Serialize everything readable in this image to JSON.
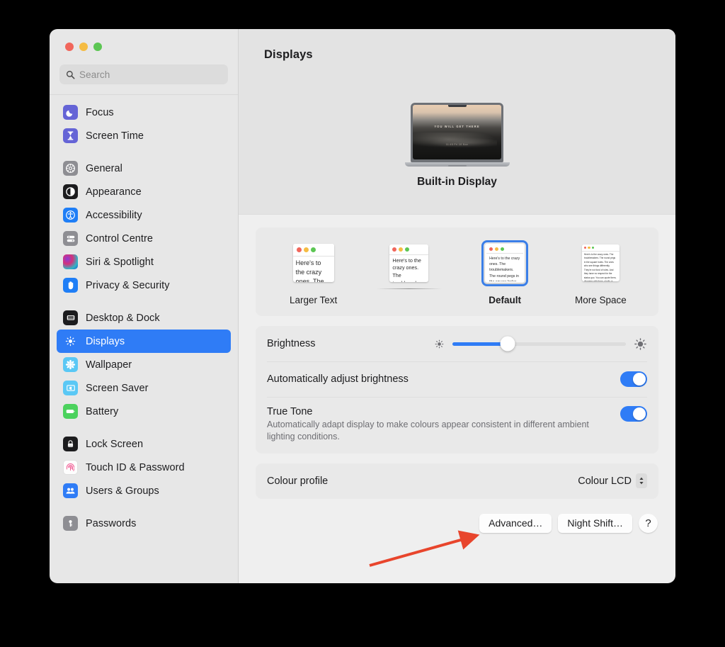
{
  "window": {
    "traffic_lights": [
      "close",
      "minimise",
      "zoom"
    ]
  },
  "sidebar": {
    "search": {
      "placeholder": "Search",
      "value": ""
    },
    "groups": [
      {
        "items": [
          {
            "label": "Focus",
            "icon": "moon-icon"
          },
          {
            "label": "Screen Time",
            "icon": "hourglass-icon"
          }
        ]
      },
      {
        "items": [
          {
            "label": "General",
            "icon": "gear-icon"
          },
          {
            "label": "Appearance",
            "icon": "appearance-icon"
          },
          {
            "label": "Accessibility",
            "icon": "accessibility-icon"
          },
          {
            "label": "Control Centre",
            "icon": "control-centre-icon"
          },
          {
            "label": "Siri & Spotlight",
            "icon": "siri-icon"
          },
          {
            "label": "Privacy & Security",
            "icon": "hand-icon"
          }
        ]
      },
      {
        "items": [
          {
            "label": "Desktop & Dock",
            "icon": "desktop-dock-icon"
          },
          {
            "label": "Displays",
            "icon": "brightness-icon",
            "selected": true
          },
          {
            "label": "Wallpaper",
            "icon": "wallpaper-icon"
          },
          {
            "label": "Screen Saver",
            "icon": "screen-saver-icon"
          },
          {
            "label": "Battery",
            "icon": "battery-icon"
          }
        ]
      },
      {
        "items": [
          {
            "label": "Lock Screen",
            "icon": "lock-icon"
          },
          {
            "label": "Touch ID & Password",
            "icon": "fingerprint-icon"
          },
          {
            "label": "Users & Groups",
            "icon": "users-icon"
          }
        ]
      },
      {
        "items": [
          {
            "label": "Passwords",
            "icon": "key-icon"
          }
        ]
      }
    ]
  },
  "main": {
    "title": "Displays",
    "device": {
      "name": "Built-in Display",
      "wallpaper_line1": "YOU WILL GET THERE",
      "wallpaper_line2": "11:45\nFri 10 Nov"
    },
    "resolution": {
      "options": [
        {
          "label": "Larger Text",
          "selected": false,
          "scale": 1.9
        },
        {
          "label": "",
          "selected": false,
          "scale": 1.45
        },
        {
          "label": "Default",
          "selected": true,
          "scale": 1.0
        },
        {
          "label": "More Space",
          "selected": false,
          "scale": 0.62
        }
      ],
      "preview_text": "Here's to the crazy ones. The troublemakers. The round pegs in the square holes. The ones who see things differently. They're not fond of rules. And they have no respect for the status quo. You can quote them, disagree with them, glorify or vilify them. About the only thing you can't do is ignore them. Because they change things."
    },
    "settings": {
      "brightness": {
        "label": "Brightness",
        "value_percent": 32
      },
      "auto_brightness": {
        "label": "Automatically adjust brightness",
        "on": true
      },
      "true_tone": {
        "label": "True Tone",
        "description": "Automatically adapt display to make colours appear consistent in different ambient lighting conditions.",
        "on": true
      }
    },
    "colour_profile": {
      "label": "Colour profile",
      "value": "Colour LCD"
    },
    "buttons": {
      "advanced": "Advanced…",
      "night_shift": "Night Shift…",
      "help": "?"
    }
  },
  "annotation": {
    "target": "advanced-button",
    "colour": "#e8452c"
  }
}
